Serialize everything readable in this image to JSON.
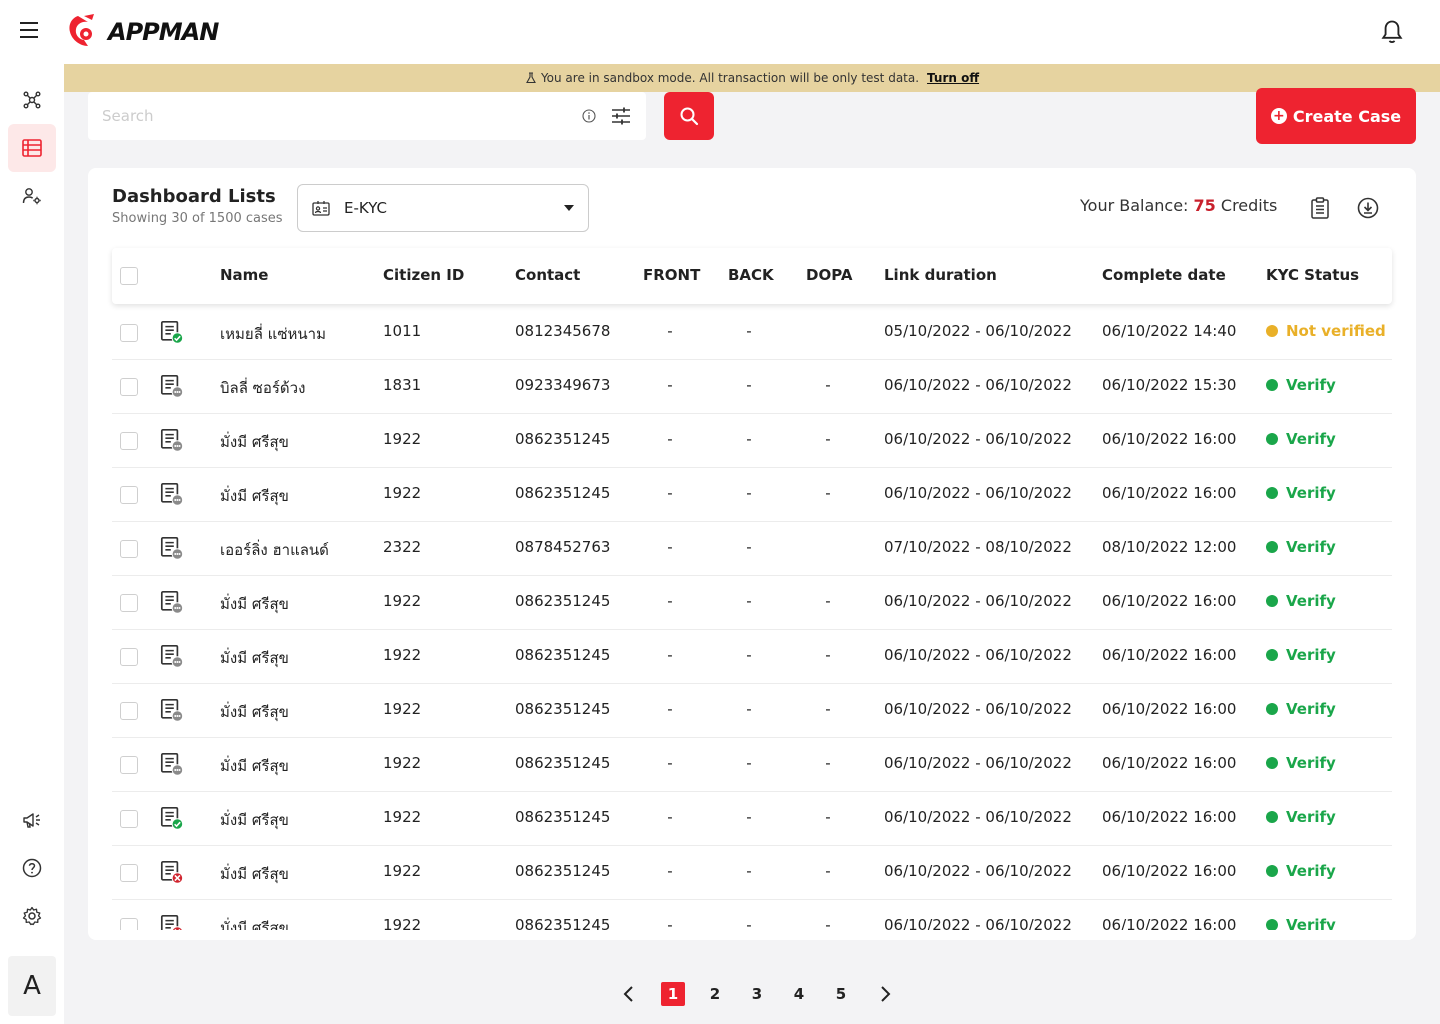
{
  "brand": {
    "name": "APPMAN",
    "accent": "#ee2330"
  },
  "banner": {
    "text": "You are in sandbox mode. All transaction will be only test data.",
    "action": "Turn off",
    "bg": "#e6d3a0"
  },
  "search": {
    "placeholder": "Search"
  },
  "create_button": "Create Case",
  "card": {
    "title": "Dashboard Lists",
    "subtitle": "Showing 30 of 1500 cases",
    "dropdown": "E-KYC",
    "balance_label": "Your Balance:",
    "balance_value": "75",
    "balance_unit": "Credits"
  },
  "columns": [
    "Name",
    "Citizen ID",
    "Contact",
    "FRONT",
    "BACK",
    "DOPA",
    "Link duration",
    "Complete date",
    "KYC Status"
  ],
  "rows": [
    {
      "icon": "check",
      "name": "เหมยลี่ แซ่หนาม",
      "citizen_id": "1011",
      "contact": "0812345678",
      "front": "-",
      "back": "-",
      "dopa": "",
      "link_duration": "05/10/2022 - 06/10/2022",
      "complete_date": "06/10/2022 14:40",
      "status": "Not verified",
      "status_color": "#e9b028"
    },
    {
      "icon": "pending",
      "name": "บิลลี่ ซอร์ด้วง",
      "citizen_id": "1831",
      "contact": "0923349673",
      "front": "-",
      "back": "-",
      "dopa": "-",
      "link_duration": "06/10/2022 - 06/10/2022",
      "complete_date": "06/10/2022 15:30",
      "status": "Verify",
      "status_color": "#1aa64a"
    },
    {
      "icon": "pending",
      "name": "มั่งมี ศรีสุข",
      "citizen_id": "1922",
      "contact": "0862351245",
      "front": "-",
      "back": "-",
      "dopa": "-",
      "link_duration": "06/10/2022 - 06/10/2022",
      "complete_date": "06/10/2022 16:00",
      "status": "Verify",
      "status_color": "#1aa64a"
    },
    {
      "icon": "pending",
      "name": "มั่งมี ศรีสุข",
      "citizen_id": "1922",
      "contact": "0862351245",
      "front": "-",
      "back": "-",
      "dopa": "-",
      "link_duration": "06/10/2022 - 06/10/2022",
      "complete_date": "06/10/2022 16:00",
      "status": "Verify",
      "status_color": "#1aa64a"
    },
    {
      "icon": "pending",
      "name": "เออร์ลิ่ง ฮาแลนด์",
      "citizen_id": "2322",
      "contact": "0878452763",
      "front": "-",
      "back": "-",
      "dopa": "",
      "link_duration": "07/10/2022 - 08/10/2022",
      "complete_date": "08/10/2022 12:00",
      "status": "Verify",
      "status_color": "#1aa64a"
    },
    {
      "icon": "pending",
      "name": "มั่งมี ศรีสุข",
      "citizen_id": "1922",
      "contact": "0862351245",
      "front": "-",
      "back": "-",
      "dopa": "-",
      "link_duration": "06/10/2022 - 06/10/2022",
      "complete_date": "06/10/2022 16:00",
      "status": "Verify",
      "status_color": "#1aa64a"
    },
    {
      "icon": "pending",
      "name": "มั่งมี ศรีสุข",
      "citizen_id": "1922",
      "contact": "0862351245",
      "front": "-",
      "back": "-",
      "dopa": "-",
      "link_duration": "06/10/2022 - 06/10/2022",
      "complete_date": "06/10/2022 16:00",
      "status": "Verify",
      "status_color": "#1aa64a"
    },
    {
      "icon": "pending",
      "name": "มั่งมี ศรีสุข",
      "citizen_id": "1922",
      "contact": "0862351245",
      "front": "-",
      "back": "-",
      "dopa": "-",
      "link_duration": "06/10/2022 - 06/10/2022",
      "complete_date": "06/10/2022 16:00",
      "status": "Verify",
      "status_color": "#1aa64a"
    },
    {
      "icon": "pending",
      "name": "มั่งมี ศรีสุข",
      "citizen_id": "1922",
      "contact": "0862351245",
      "front": "-",
      "back": "-",
      "dopa": "-",
      "link_duration": "06/10/2022 - 06/10/2022",
      "complete_date": "06/10/2022 16:00",
      "status": "Verify",
      "status_color": "#1aa64a"
    },
    {
      "icon": "check",
      "name": "มั่งมี ศรีสุข",
      "citizen_id": "1922",
      "contact": "0862351245",
      "front": "-",
      "back": "-",
      "dopa": "-",
      "link_duration": "06/10/2022 - 06/10/2022",
      "complete_date": "06/10/2022 16:00",
      "status": "Verify",
      "status_color": "#1aa64a"
    },
    {
      "icon": "error",
      "name": "มั่งมี ศรีสุข",
      "citizen_id": "1922",
      "contact": "0862351245",
      "front": "-",
      "back": "-",
      "dopa": "-",
      "link_duration": "06/10/2022 - 06/10/2022",
      "complete_date": "06/10/2022 16:00",
      "status": "Verify",
      "status_color": "#1aa64a"
    },
    {
      "icon": "error",
      "name": "มั่งมี ศรีสุข",
      "citizen_id": "1922",
      "contact": "0862351245",
      "front": "-",
      "back": "-",
      "dopa": "-",
      "link_duration": "06/10/2022 - 06/10/2022",
      "complete_date": "06/10/2022 16:00",
      "status": "Verify",
      "status_color": "#1aa64a"
    }
  ],
  "pagination": {
    "pages": [
      "1",
      "2",
      "3",
      "4",
      "5"
    ],
    "current": "1"
  },
  "sidebar": {
    "items": [
      "network-icon",
      "list-icon",
      "user-settings-icon"
    ],
    "bottom": [
      "megaphone-icon",
      "help-icon",
      "gear-icon"
    ],
    "avatar": "A"
  }
}
